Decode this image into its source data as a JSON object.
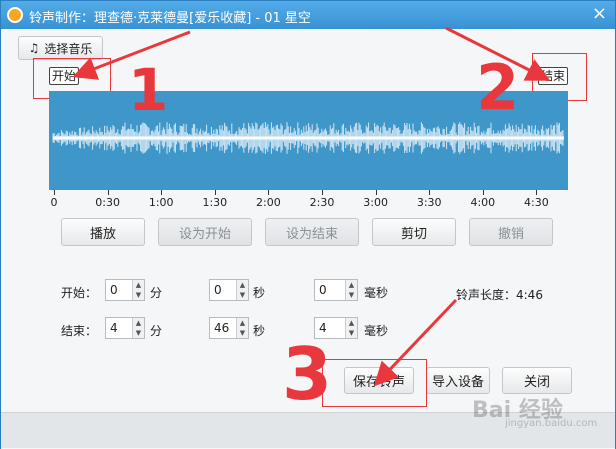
{
  "window": {
    "title": "铃声制作：理查德·克莱德曼[爱乐收藏] - 01 星空",
    "app_icon": "ringtone-app-icon",
    "close_glyph": "×"
  },
  "toolbar": {
    "select_music_label": "选择音乐",
    "select_music_icon": "music-note-icon"
  },
  "markers": {
    "start": "开始",
    "end": "结束"
  },
  "timeline": {
    "labels": [
      "0",
      "0:30",
      "1:00",
      "1:30",
      "2:00",
      "2:30",
      "3:00",
      "3:30",
      "4:00",
      "4:30"
    ]
  },
  "controls": {
    "play": "播放",
    "set_start": "设为开始",
    "set_end": "设为结束",
    "cut": "剪切",
    "undo": "撤销"
  },
  "start_row": {
    "label": "开始：",
    "min": "0",
    "min_unit": "分",
    "sec": "0",
    "sec_unit": "秒",
    "ms": "0",
    "ms_unit": "毫秒"
  },
  "end_row": {
    "label": "结束：",
    "min": "4",
    "min_unit": "分",
    "sec": "46",
    "sec_unit": "秒",
    "ms": "4",
    "ms_unit": "毫秒"
  },
  "ringtone_length": "铃声长度：4:46",
  "actions": {
    "save": "保存铃声",
    "import": "导入设备",
    "close": "关闭"
  },
  "annotations": {
    "one": "1",
    "two": "2",
    "three": "3"
  },
  "watermark": {
    "logo": "Bai 经验",
    "url": "jingyan.baidu.com"
  },
  "colors": {
    "waveform_bg": "#3f97c9",
    "titlebar": "#3d97d8",
    "annotation": "#e8383d"
  }
}
